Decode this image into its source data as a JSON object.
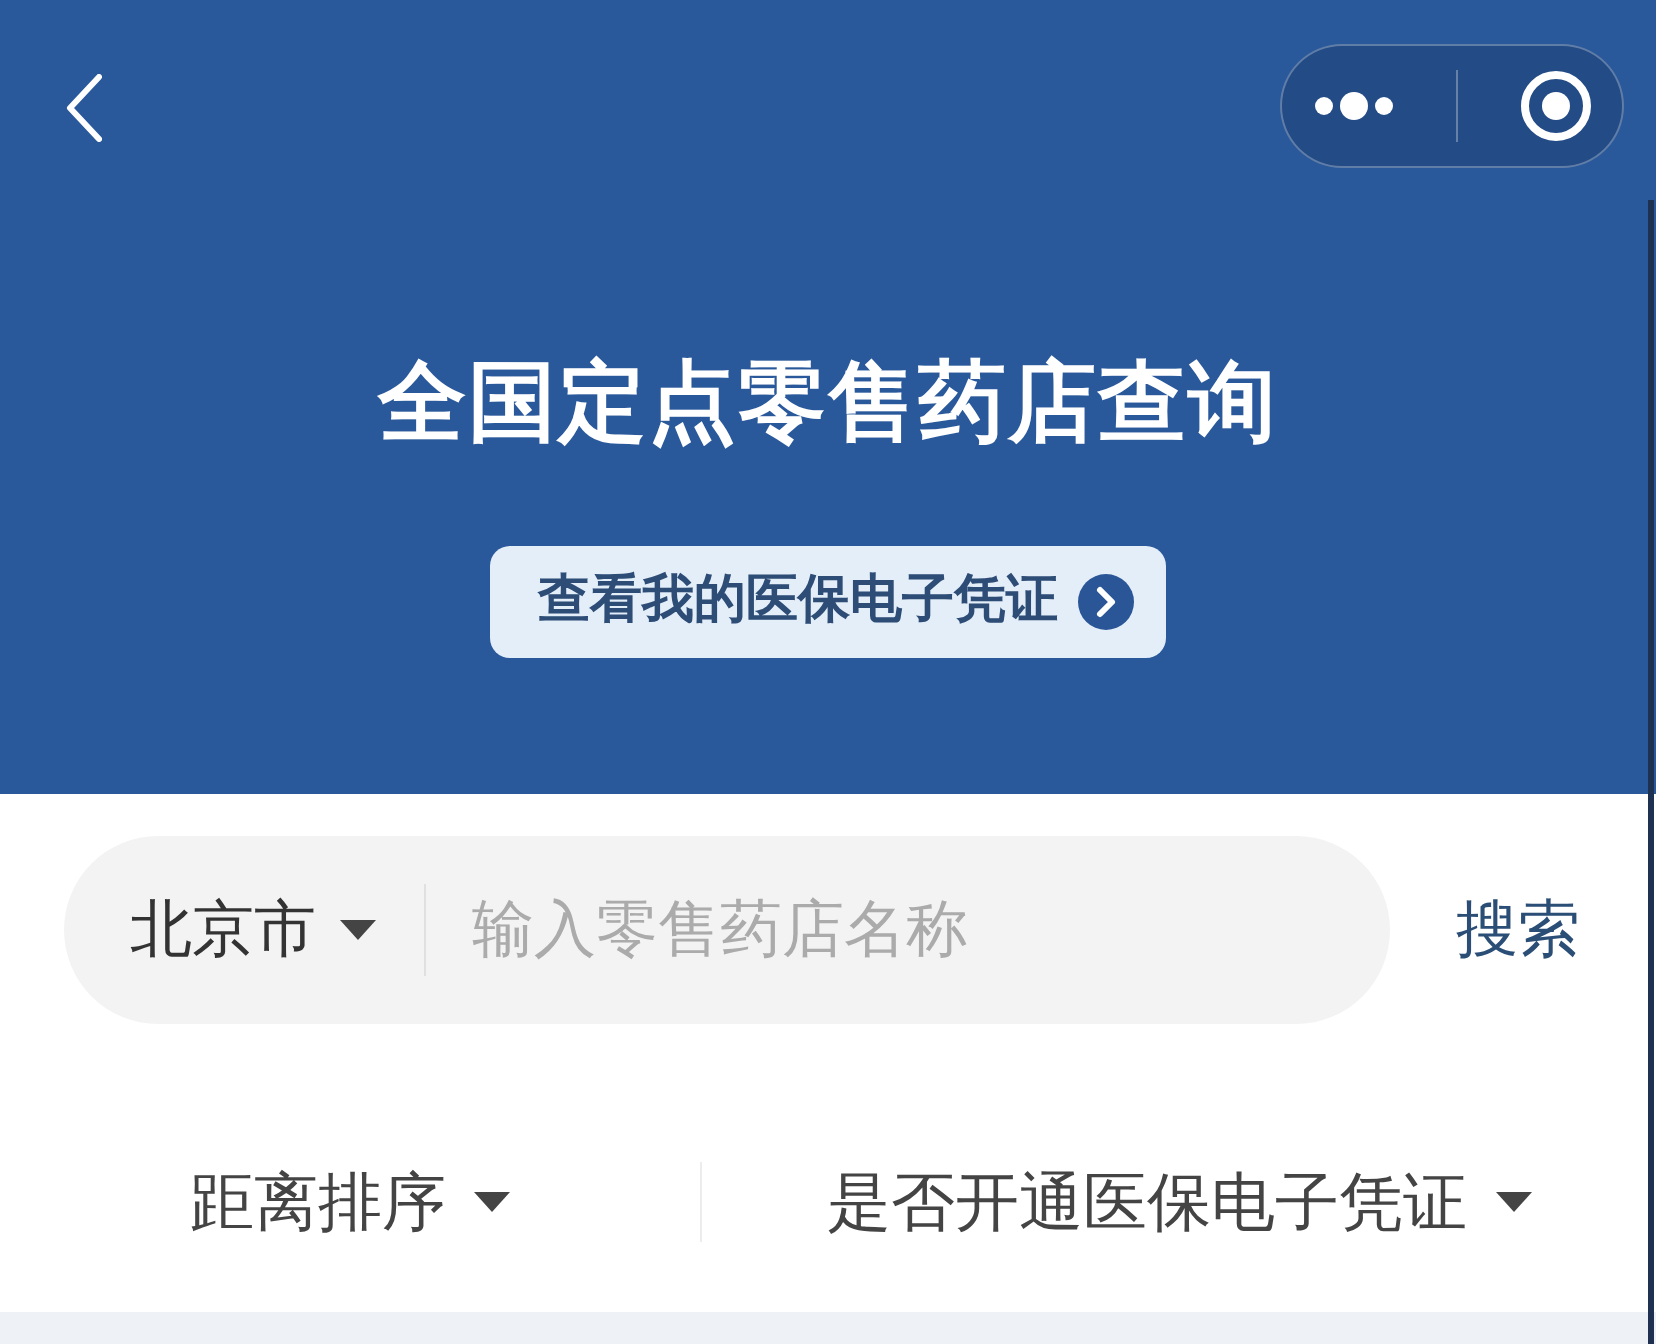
{
  "header": {
    "title": "全国定点零售药店查询",
    "voucher_button": "查看我的医保电子凭证"
  },
  "search": {
    "city": "北京市",
    "placeholder": "输入零售药店名称",
    "button": "搜索"
  },
  "filters": [
    {
      "label": "距离排序"
    },
    {
      "label": "是否开通医保电子凭证"
    }
  ]
}
